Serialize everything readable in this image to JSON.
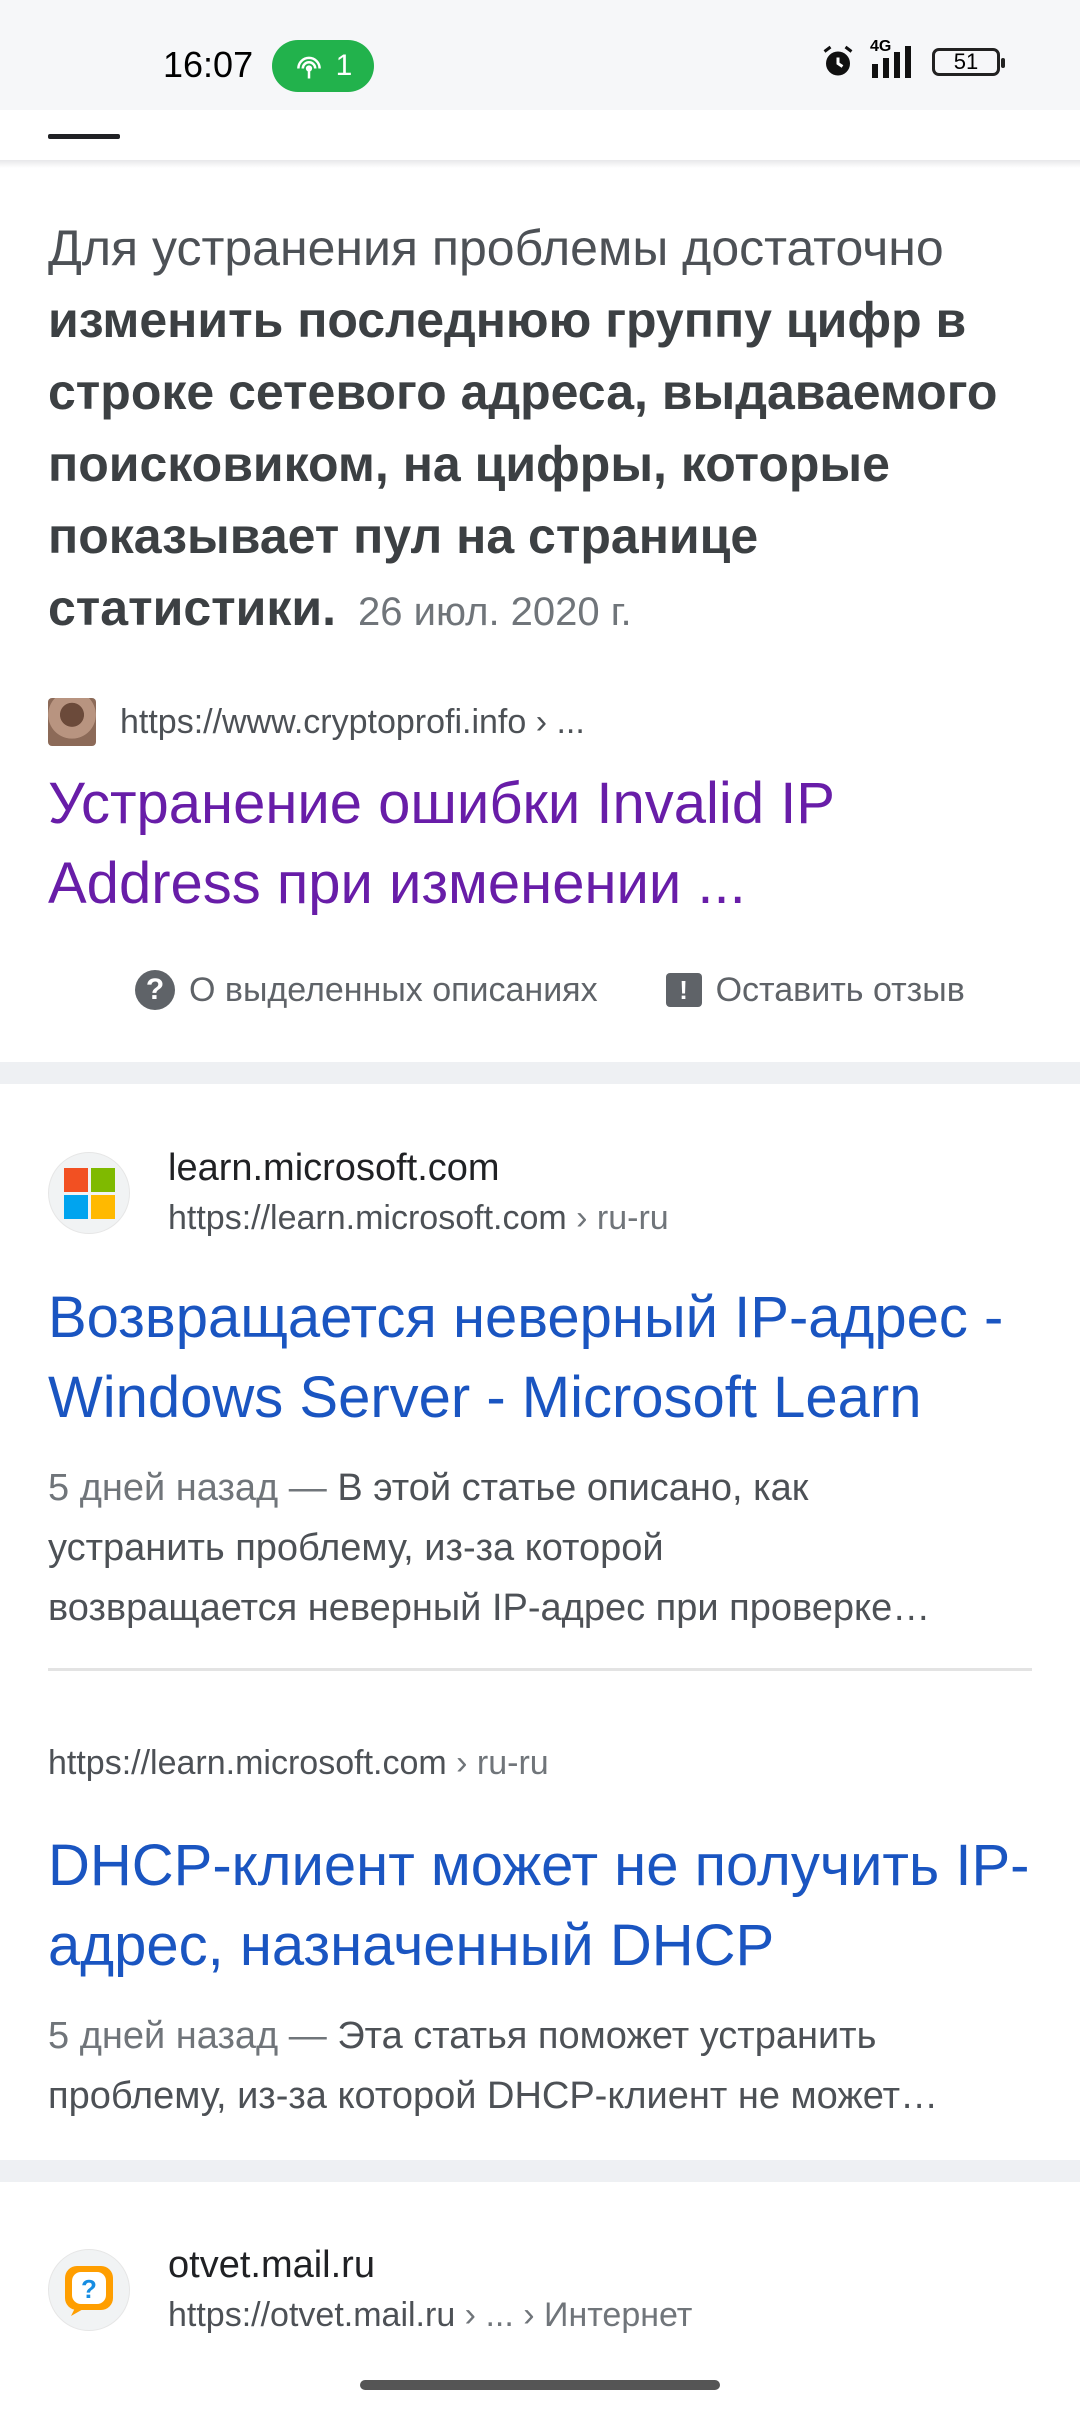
{
  "status": {
    "time": "16:07",
    "hotspot_count": "1",
    "network": "4G",
    "battery": "51"
  },
  "snippet": {
    "lead": "Для устранения проблемы достаточно ",
    "bold": "изменить последнюю группу цифр в строке сетевого адреса, выдаваемого поисковиком, на цифры, которые показывает пул на странице статистики",
    "tail": ".",
    "date": "26 июл. 2020 г.",
    "source_url": "https://www.cryptoprofi.info › ...",
    "title": "Устранение ошибки Invalid IP Address при изменении ..."
  },
  "about": {
    "featured_label": "О выделенных описаниях",
    "feedback_label": "Оставить отзыв"
  },
  "results": [
    {
      "site_name": "learn.microsoft.com",
      "url": "https://learn.microsoft.com",
      "crumb": " › ru-ru",
      "title": "Возвращается неверный IP-адрес - Windows Server - Microsoft Learn",
      "age": "5 дней назад",
      "dash": " — ",
      "desc_line1": "В этой статье описано, как",
      "desc_line2": "устранить проблему, из-за которой",
      "desc_line3": "возвращается неверный IP-адрес при проверке…"
    },
    {
      "url": "https://learn.microsoft.com",
      "crumb": " › ru-ru",
      "title": "DHCP-клиент может не получить IP-адрес, назначенный DHCP",
      "age": "5 дней назад",
      "dash": " — ",
      "desc_line1": "Эта статья поможет устранить",
      "desc_line2": "проблему, из-за которой DHCP-клиент не может…"
    },
    {
      "site_name": "otvet.mail.ru",
      "url": "https://otvet.mail.ru",
      "crumb": " › ... › Интернет"
    }
  ],
  "colors": {
    "visited_link": "#681da8",
    "link": "#1a55c1",
    "hotspot": "#22b24c"
  }
}
